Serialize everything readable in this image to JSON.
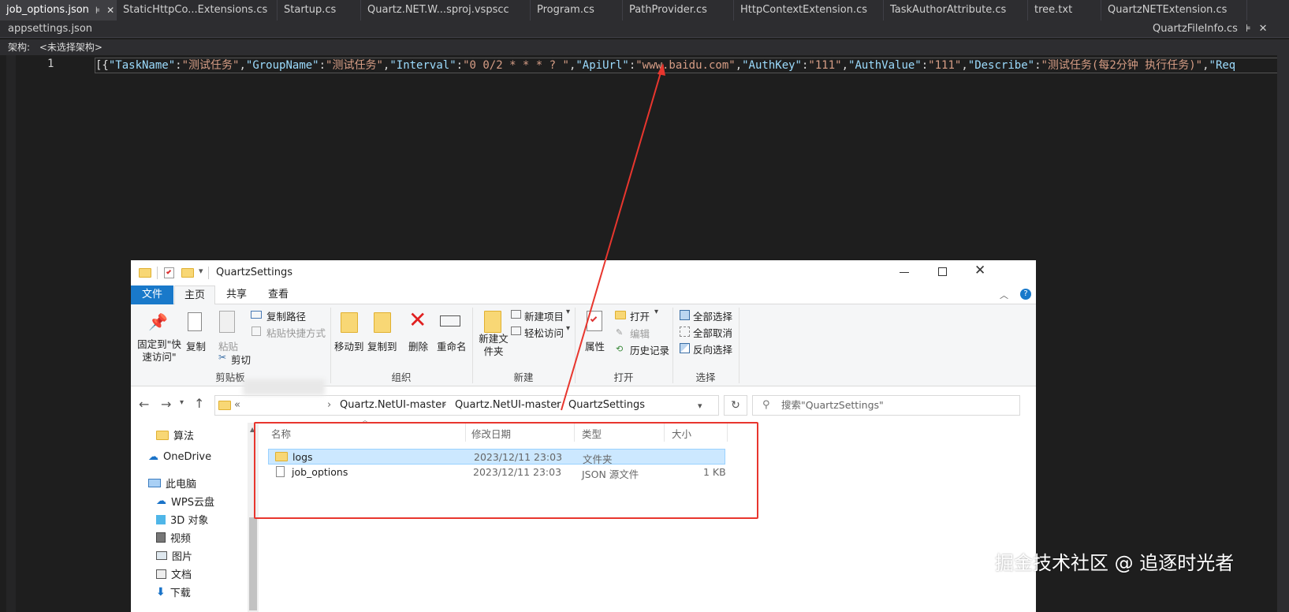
{
  "vs": {
    "tabs": [
      "job_options.json",
      "StaticHttpCo...Extensions.cs",
      "Startup.cs",
      "Quartz.NET.W...sproj.vspscc",
      "Program.cs",
      "PathProvider.cs",
      "HttpContextExtension.cs",
      "TaskAuthorAttribute.cs",
      "tree.txt",
      "QuartzNETExtension.cs"
    ],
    "pin_glyph": "⊧",
    "close_glyph": "✕",
    "tab2_left": "appsettings.json",
    "tab2_right": "QuartzFileInfo.cs",
    "arch_label": "架构:",
    "arch_value": "<未选择架构>",
    "line_number": "1",
    "code": {
      "open": "[{",
      "k1": "\"TaskName\"",
      "v1": "\"测试任务\"",
      "k2": "\"GroupName\"",
      "v2": "\"测试任务\"",
      "k3": "\"Interval\"",
      "v3": "\"0 0/2 * * * ? \"",
      "k4": "\"ApiUrl\"",
      "v4": "\"www.baidu.com\"",
      "k5": "\"AuthKey\"",
      "v5": "\"111\"",
      "k6": "\"AuthValue\"",
      "v6": "\"111\"",
      "k7": "\"Describe\"",
      "v7": "\"测试任务(每2分钟 执行任务)\"",
      "k8": "\"Req"
    }
  },
  "explorer": {
    "title": "QuartzSettings",
    "ribbon_tabs": [
      "文件",
      "主页",
      "共享",
      "查看"
    ],
    "clipboard": {
      "pin": "固定到\"快速访问\"",
      "copy": "复制",
      "paste": "粘贴",
      "copy_path": "复制路径",
      "paste_shortcut": "粘贴快捷方式",
      "cut": "剪切",
      "group": "剪贴板"
    },
    "organize": {
      "move_to": "移动到",
      "copy_to": "复制到",
      "delete": "删除",
      "rename": "重命名",
      "group": "组织"
    },
    "new": {
      "new_folder": "新建文件夹",
      "new_item": "新建项目",
      "easy_access": "轻松访问",
      "group": "新建"
    },
    "open": {
      "properties": "属性",
      "open": "打开",
      "edit": "编辑",
      "history": "历史记录",
      "group": "打开"
    },
    "select": {
      "select_all": "全部选择",
      "select_none": "全部取消",
      "invert": "反向选择",
      "group": "选择"
    },
    "breadcrumb": [
      "Quartz.NetUI-master",
      "Quartz.NetUI-master",
      "QuartzSettings"
    ],
    "breadcrumb_prefix": "«",
    "search_placeholder": "搜索\"QuartzSettings\"",
    "nav": [
      "算法",
      "OneDrive",
      "此电脑",
      "WPS云盘",
      "3D 对象",
      "视频",
      "图片",
      "文档",
      "下载"
    ],
    "columns": [
      "名称",
      "修改日期",
      "类型",
      "大小"
    ],
    "files": [
      {
        "name": "logs",
        "date": "2023/12/11 23:03",
        "type": "文件夹",
        "size": ""
      },
      {
        "name": "job_options",
        "date": "2023/12/11 23:03",
        "type": "JSON 源文件",
        "size": "1 KB"
      }
    ]
  },
  "watermark": "掘金技术社区 @ 追逐时光者"
}
